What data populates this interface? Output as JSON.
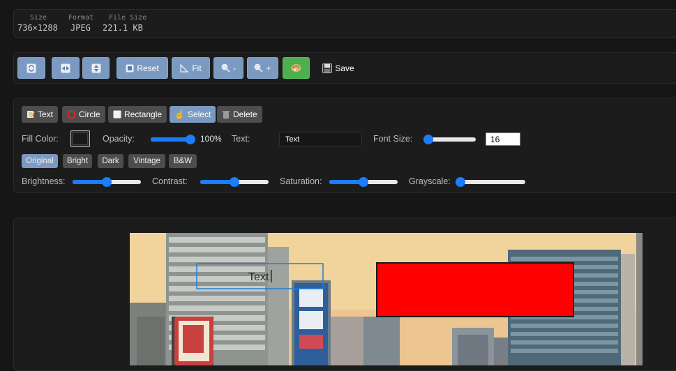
{
  "info": {
    "size_label": "Size",
    "size_value": "736×1288",
    "format_label": "Format",
    "format_value": "JPEG",
    "filesize_label": "File Size",
    "filesize_value": "221.1 KB"
  },
  "toolbar": {
    "rotate_icon": "rotate-icon",
    "flip_h_icon": "flip-horizontal-icon",
    "flip_v_icon": "flip-vertical-icon",
    "reset_label": "Reset",
    "fit_label": "Fit",
    "zoom_out_label": "-",
    "zoom_in_label": "+",
    "palette_icon": "palette-icon",
    "save_label": "Save"
  },
  "tools": {
    "text_label": "Text",
    "circle_label": "Circle",
    "rectangle_label": "Rectangle",
    "select_label": "Select",
    "delete_label": "Delete",
    "active_tool": "Select"
  },
  "props": {
    "fill_color_label": "Fill Color:",
    "fill_color": "#1a1a1a",
    "opacity_label": "Opacity:",
    "opacity_value": "100%",
    "opacity_level": 1.0,
    "text_label": "Text:",
    "text_value": "Text",
    "font_size_label": "Font Size:",
    "font_size_value": "16",
    "font_size_level": 0.08
  },
  "filters": {
    "items": [
      "Original",
      "Bright",
      "Dark",
      "Vintage",
      "B&W"
    ],
    "active": "Original"
  },
  "adjust": {
    "brightness_label": "Brightness:",
    "brightness_level": 0.5,
    "contrast_label": "Contrast:",
    "contrast_level": 0.5,
    "saturation_label": "Saturation:",
    "saturation_level": 0.5,
    "grayscale_label": "Grayscale:",
    "grayscale_level": 0.0
  },
  "canvas": {
    "text_object": "Text",
    "rect_fill": "#ff0000",
    "accent": "#1a7cff"
  }
}
